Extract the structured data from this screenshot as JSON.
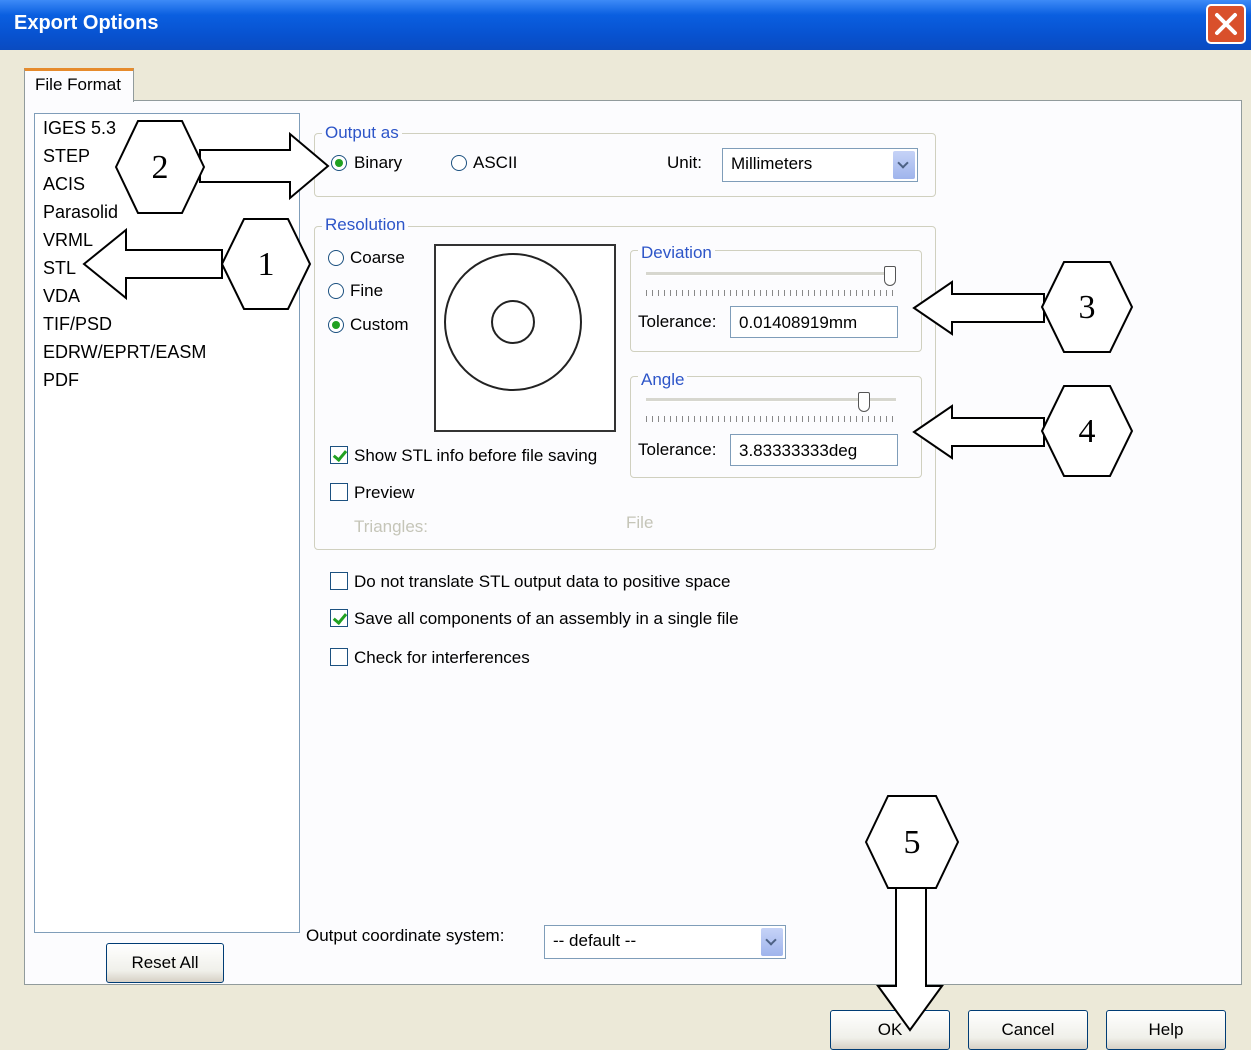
{
  "window": {
    "title": "Export Options"
  },
  "tab": {
    "label": "File Format"
  },
  "formats": [
    "IGES 5.3",
    "STEP",
    "ACIS",
    "Parasolid",
    "VRML",
    "STL",
    "VDA",
    "TIF/PSD",
    "EDRW/EPRT/EASM",
    "PDF"
  ],
  "output_as": {
    "label": "Output as",
    "binary": "Binary",
    "ascii": "ASCII",
    "selected": "Binary",
    "unit_label": "Unit:",
    "unit_value": "Millimeters"
  },
  "resolution": {
    "label": "Resolution",
    "coarse": "Coarse",
    "fine": "Fine",
    "custom": "Custom",
    "selected": "Custom"
  },
  "deviation": {
    "label": "Deviation",
    "tolerance_label": "Tolerance:",
    "tolerance_value": "0.01408919mm"
  },
  "angle": {
    "label": "Angle",
    "tolerance_label": "Tolerance:",
    "tolerance_value": "3.83333333deg"
  },
  "options": {
    "show_stl_info": "Show STL info before file saving",
    "preview": "Preview",
    "triangles": "Triangles:",
    "file_size": "File",
    "no_translate": "Do not translate STL output data to positive space",
    "save_components": "Save all components of an assembly in a single file",
    "check_interference": "Check for interferences"
  },
  "coord": {
    "label": "Output coordinate system:",
    "value": "-- default --"
  },
  "buttons": {
    "reset_all": "Reset All",
    "ok": "OK",
    "cancel": "Cancel",
    "help": "Help"
  },
  "callouts": [
    "1",
    "2",
    "3",
    "4",
    "5"
  ]
}
